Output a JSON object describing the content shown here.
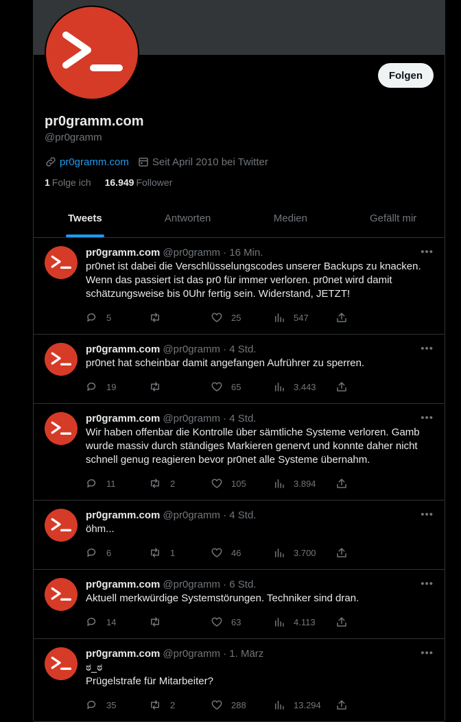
{
  "profile": {
    "name": "pr0gramm.com",
    "handle": "@pr0gramm",
    "website": "pr0gramm.com",
    "joined": "Seit April 2010 bei Twitter",
    "following_count": "1",
    "following_label": "Folge ich",
    "followers_count": "16.949",
    "followers_label": "Follower",
    "follow_button": "Folgen",
    "avatar_color": "#d63b27"
  },
  "tabs": [
    {
      "label": "Tweets",
      "active": true
    },
    {
      "label": "Antworten",
      "active": false
    },
    {
      "label": "Medien",
      "active": false
    },
    {
      "label": "Gefällt mir",
      "active": false
    }
  ],
  "tweets": [
    {
      "name": "pr0gramm.com",
      "meta": "@pr0gramm · 16 Min.",
      "text": "pr0net ist dabei die Verschlüsselungscodes unserer Backups zu knacken.\nWenn das passiert ist das pr0 für immer verloren. pr0net wird damit\nschätzungsweise bis 0Uhr fertig sein. Widerstand, JETZT!",
      "replies": "5",
      "retweets": "",
      "likes": "25",
      "views": "547"
    },
    {
      "name": "pr0gramm.com",
      "meta": "@pr0gramm · 4 Std.",
      "text": "pr0net hat scheinbar damit angefangen Aufrührer zu sperren.",
      "replies": "19",
      "retweets": "",
      "likes": "65",
      "views": "3.443"
    },
    {
      "name": "pr0gramm.com",
      "meta": "@pr0gramm · 4 Std.",
      "text": "Wir haben offenbar die Kontrolle über sämtliche Systeme verloren. Gamb\nwurde massiv durch ständiges Markieren genervt und konnte daher nicht\nschnell genug reagieren bevor pr0net alle Systeme übernahm.",
      "replies": "11",
      "retweets": "2",
      "likes": "105",
      "views": "3.894"
    },
    {
      "name": "pr0gramm.com",
      "meta": "@pr0gramm · 4 Std.",
      "text": "öhm...",
      "replies": "6",
      "retweets": "1",
      "likes": "46",
      "views": "3.700"
    },
    {
      "name": "pr0gramm.com",
      "meta": "@pr0gramm · 6 Std.",
      "text": "Aktuell merkwürdige Systemstörungen. Techniker sind dran.",
      "replies": "14",
      "retweets": "",
      "likes": "63",
      "views": "4.113"
    },
    {
      "name": "pr0gramm.com",
      "meta": "@pr0gramm · 1. März",
      "text": "ಠ_ಠ\nPrügelstrafe für Mitarbeiter?",
      "replies": "35",
      "retweets": "2",
      "likes": "288",
      "views": "13.294"
    }
  ]
}
